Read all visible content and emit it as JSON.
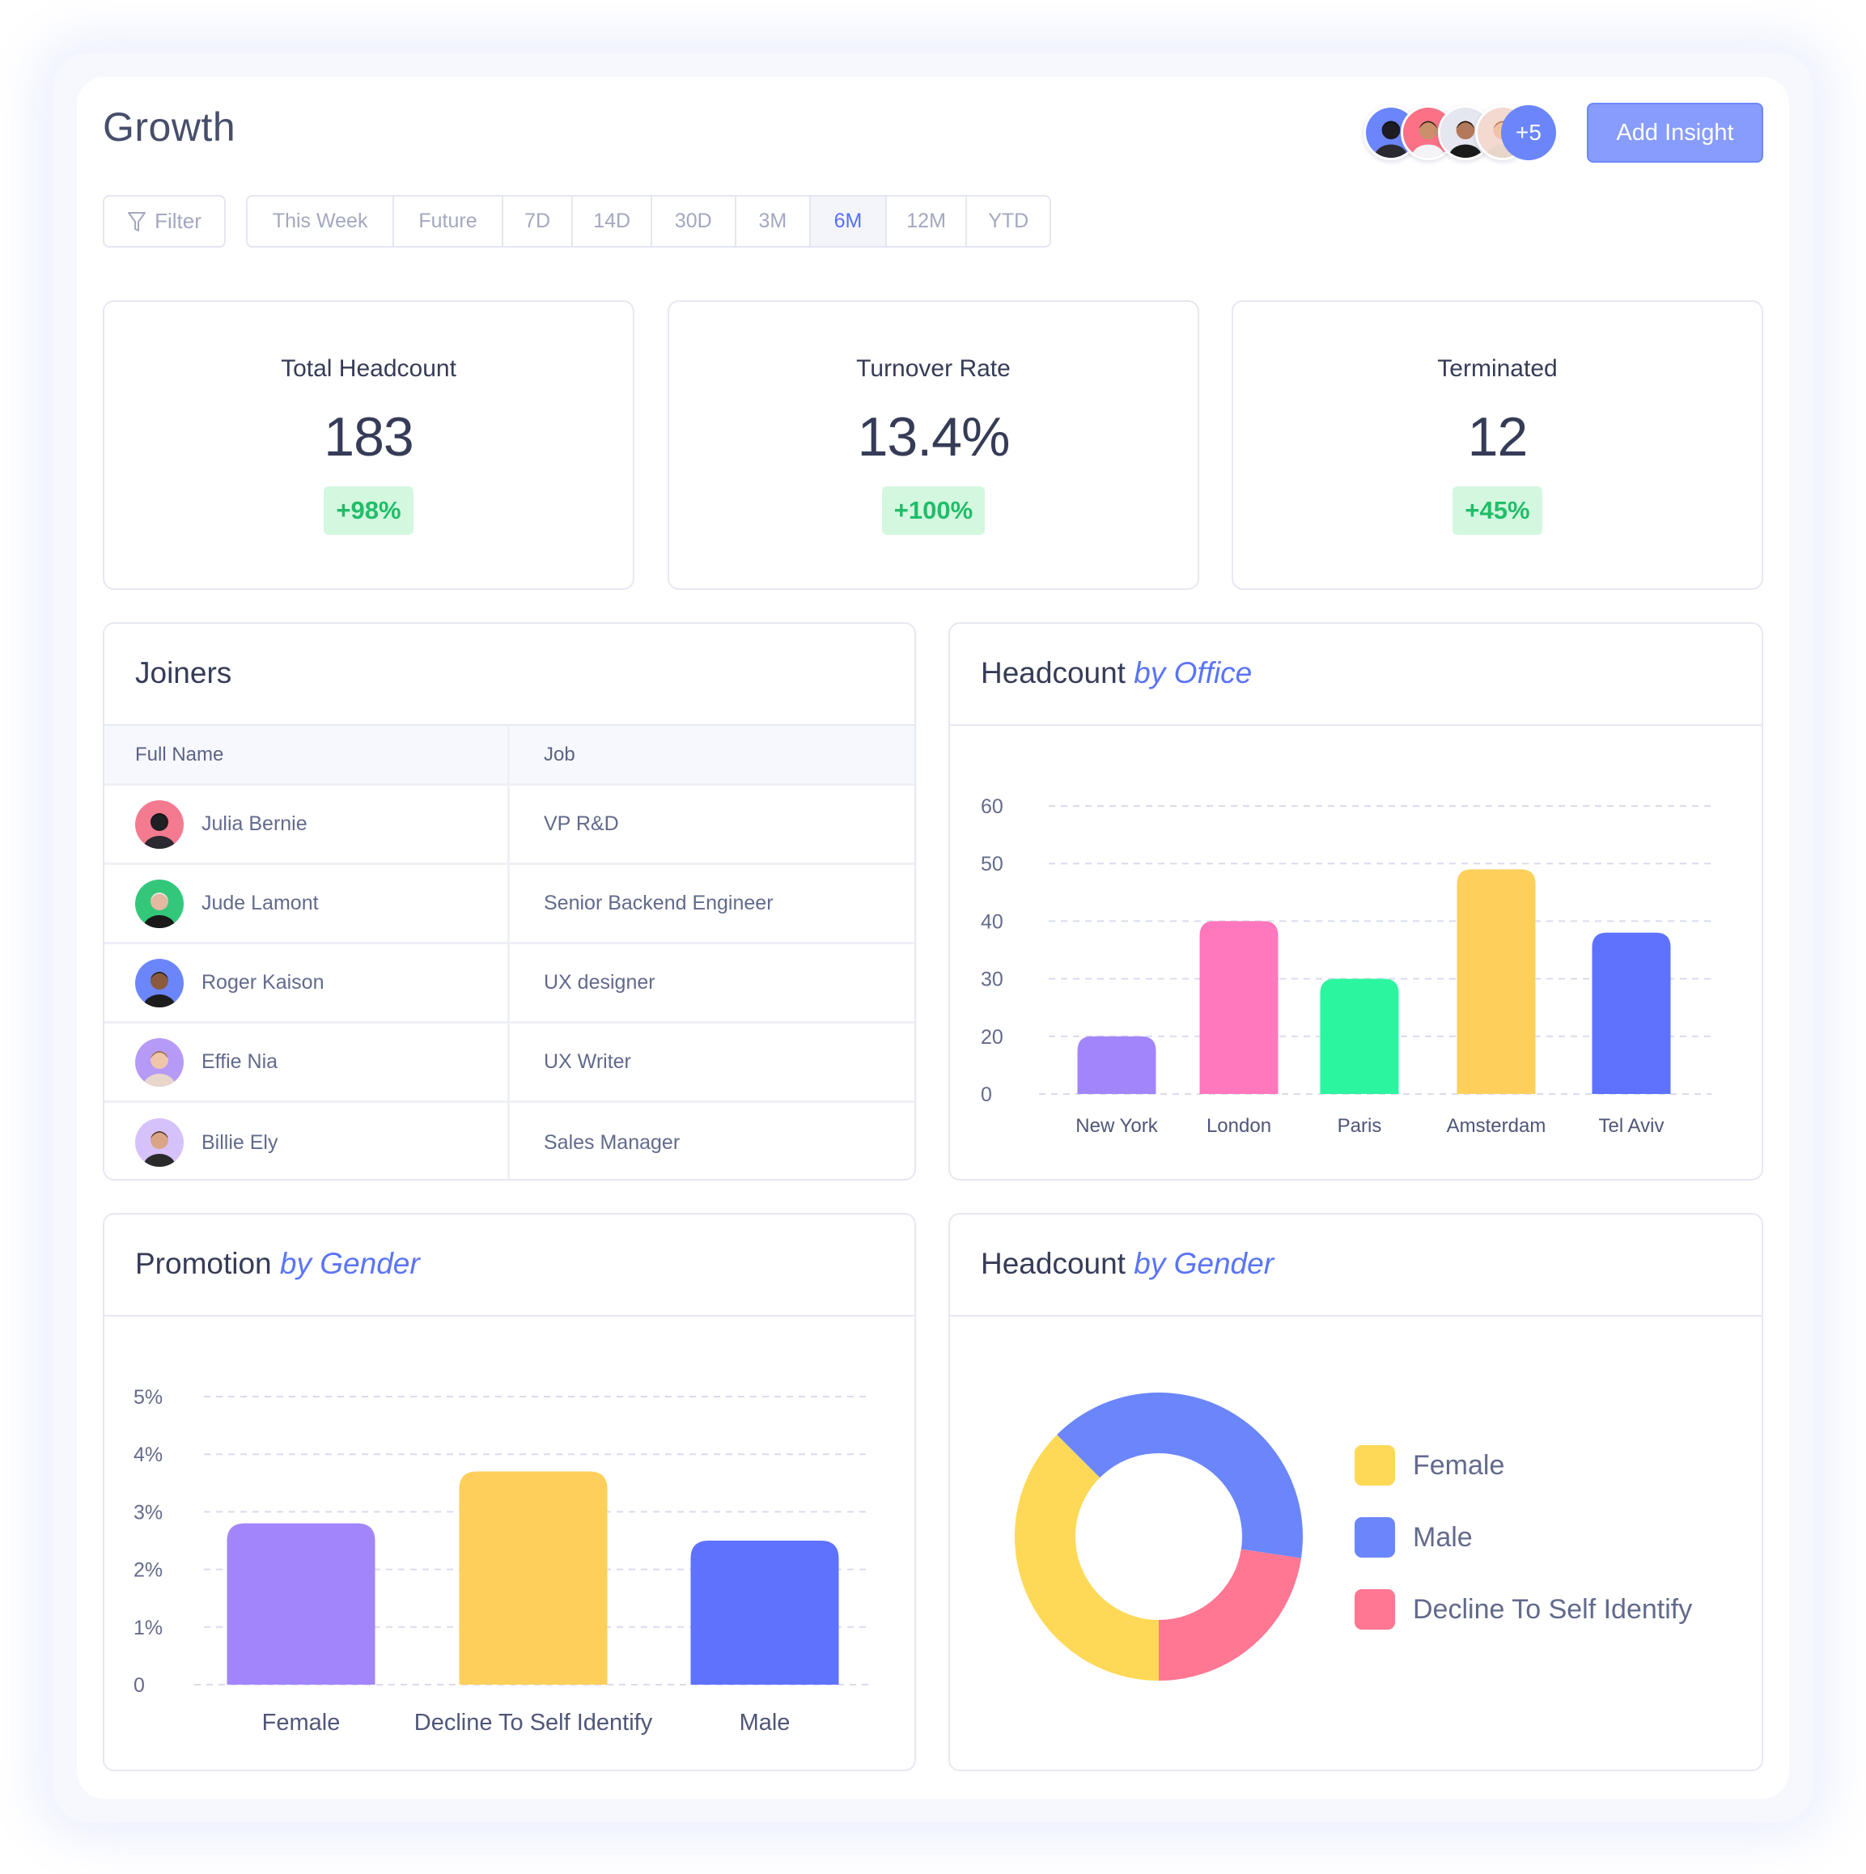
{
  "page": {
    "title": "Growth",
    "filter_label": "Filter",
    "add_insight_label": "Add Insight",
    "more_members_label": "+5",
    "periods": [
      {
        "label": "This Week",
        "active": false
      },
      {
        "label": "Future",
        "active": false
      },
      {
        "label": "7D",
        "active": false
      },
      {
        "label": "14D",
        "active": false
      },
      {
        "label": "30D",
        "active": false
      },
      {
        "label": "3M",
        "active": false
      },
      {
        "label": "6M",
        "active": true
      },
      {
        "label": "12M",
        "active": false
      },
      {
        "label": "YTD",
        "active": false
      }
    ],
    "team_avatars": [
      {
        "name": "dog",
        "bg": "#6b86fb"
      },
      {
        "name": "man-smiling",
        "bg": "#fb7185"
      },
      {
        "name": "woman-curly",
        "bg": "#e5e7f0"
      },
      {
        "name": "woman-blonde",
        "bg": "#f3d9d0"
      }
    ]
  },
  "stats": [
    {
      "label": "Total Headcount",
      "value": "183",
      "change": "+98%"
    },
    {
      "label": "Turnover Rate",
      "value": "13.4%",
      "change": "+100%"
    },
    {
      "label": "Terminated",
      "value": "12",
      "change": "+45%"
    }
  ],
  "joiners": {
    "title": "Joiners",
    "columns": [
      "Full Name",
      "Job"
    ],
    "rows": [
      {
        "name": "Julia Bernie",
        "job": "VP R&D",
        "avatar_bg": "#f47a8f"
      },
      {
        "name": "Jude Lamont",
        "job": "Senior Backend Engineer",
        "avatar_bg": "#33c77a"
      },
      {
        "name": "Roger Kaison",
        "job": "UX designer",
        "avatar_bg": "#6b86fb"
      },
      {
        "name": "Effie Nia",
        "job": "UX Writer",
        "avatar_bg": "#b69af8"
      },
      {
        "name": "Billie Ely",
        "job": "Sales Manager",
        "avatar_bg": "#d6c2fb"
      }
    ]
  },
  "panels": {
    "office": {
      "title": "Headcount",
      "title_em": "by Office"
    },
    "promo": {
      "title": "Promotion",
      "title_em": "by Gender"
    },
    "gender": {
      "title": "Headcount",
      "title_em": "by Gender"
    }
  },
  "colors": {
    "accent": "#5b74f6",
    "badge_bg": "#d3f8df",
    "badge_text": "#22bd69"
  },
  "chart_data": [
    {
      "id": "headcount-by-office",
      "type": "bar",
      "title": "Headcount by Office",
      "xlabel": "",
      "ylabel": "",
      "categories": [
        "New York",
        "London",
        "Paris",
        "Amsterdam",
        "Tel Aviv"
      ],
      "values": [
        20,
        40,
        30,
        49,
        38
      ],
      "colors": [
        "#a385fb",
        "#ff77bd",
        "#2cf5a0",
        "#fecf5b",
        "#5f72fd"
      ],
      "y_ticks": [
        0,
        20,
        30,
        40,
        50,
        60
      ],
      "y_tick_positions": [
        10,
        20,
        30,
        40,
        50,
        60
      ],
      "ylim": [
        10,
        60
      ],
      "grid": true
    },
    {
      "id": "promotion-by-gender",
      "type": "bar",
      "title": "Promotion by Gender",
      "xlabel": "",
      "ylabel": "",
      "categories": [
        "Female",
        "Decline To Self Identify",
        "Male"
      ],
      "values": [
        2.8,
        3.7,
        2.5
      ],
      "unit": "%",
      "colors": [
        "#a385fb",
        "#fecf5b",
        "#5f72fd"
      ],
      "y_ticks": [
        "0",
        "1%",
        "2%",
        "3%",
        "4%",
        "5%"
      ],
      "ylim": [
        0,
        5
      ],
      "grid": true
    },
    {
      "id": "headcount-by-gender",
      "type": "pie",
      "donut": true,
      "title": "Headcount by Gender",
      "legend_position": "right",
      "slices": [
        {
          "label": "Female",
          "value": 37.5,
          "color": "#fed957"
        },
        {
          "label": "Male",
          "value": 39.9,
          "color": "#6b86fb"
        },
        {
          "label": "Decline To Self Identify",
          "value": 22.6,
          "color": "#ff7792"
        }
      ]
    }
  ]
}
